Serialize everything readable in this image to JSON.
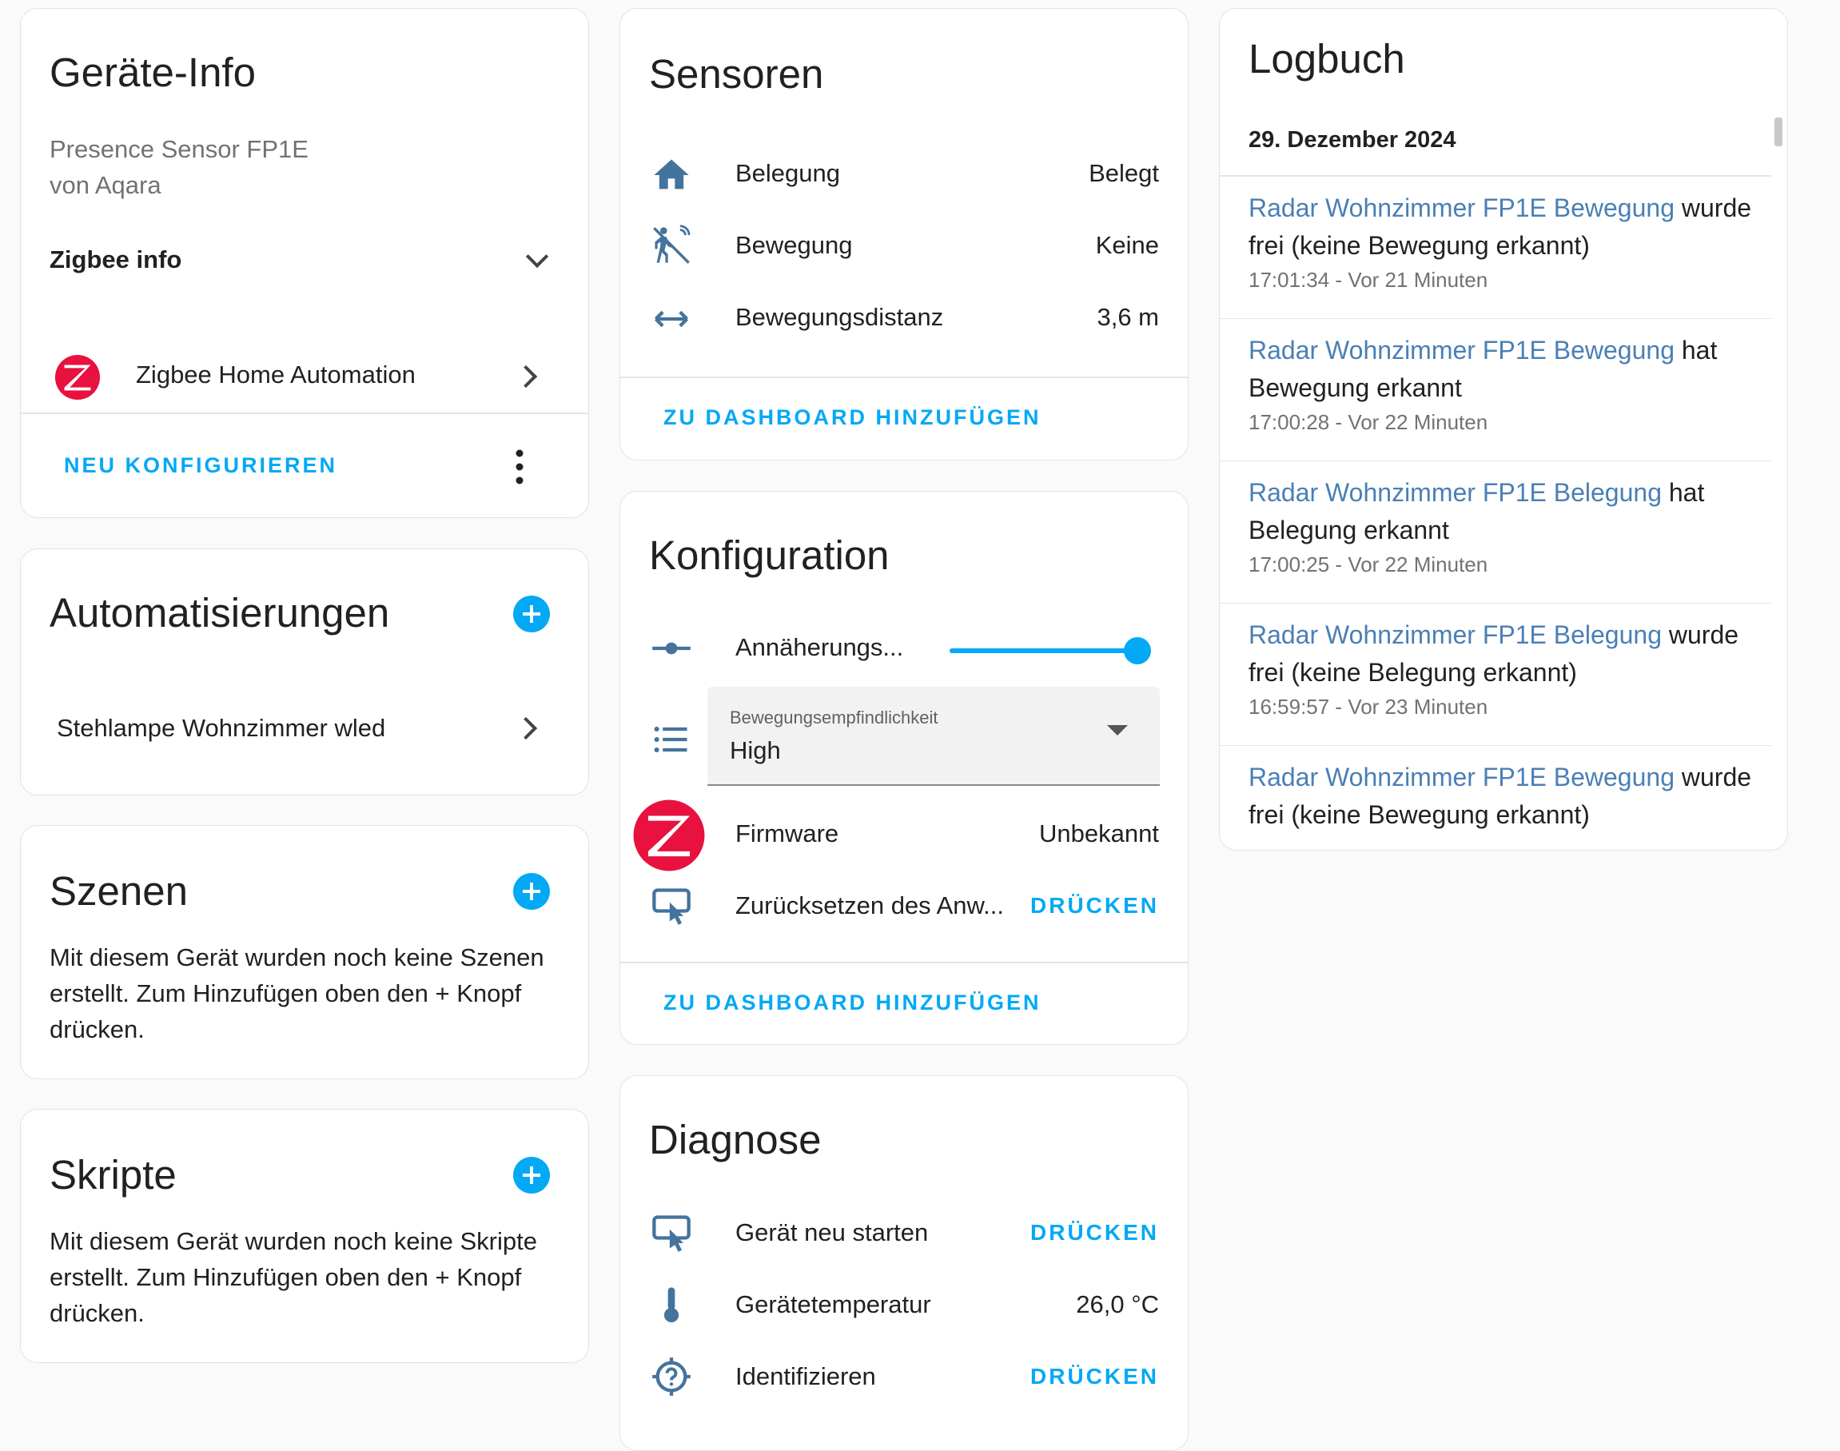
{
  "device_info": {
    "title": "Geräte-Info",
    "model": "Presence Sensor FP1E",
    "manufacturer": "von Aqara",
    "zigbee_info_label": "Zigbee info",
    "integration": "Zigbee Home Automation",
    "reconfigure_label": "NEU KONFIGURIEREN"
  },
  "automations": {
    "title": "Automatisierungen",
    "items": [
      "Stehlampe Wohnzimmer wled"
    ]
  },
  "scenes": {
    "title": "Szenen",
    "empty_text": "Mit diesem Gerät wurden noch keine Szenen erstellt. Zum Hinzufügen oben den + Knopf drücken."
  },
  "scripts": {
    "title": "Skripte",
    "empty_text": "Mit diesem Gerät wurden noch keine Skripte erstellt. Zum Hinzufügen oben den + Knopf drücken."
  },
  "sensors": {
    "title": "Sensoren",
    "rows": [
      {
        "icon": "home-icon",
        "label": "Belegung",
        "value": "Belegt"
      },
      {
        "icon": "motion-sensor-icon",
        "label": "Bewegung",
        "value": "Keine"
      },
      {
        "icon": "arrow-left-right-icon",
        "label": "Bewegungsdistanz",
        "value": "3,6 m"
      }
    ],
    "add_label": "ZU DASHBOARD HINZUFÜGEN"
  },
  "configuration": {
    "title": "Konfiguration",
    "slider_label": "Annäherungs...",
    "slider_value_fraction": 1.0,
    "select_label": "Bewegungsempfindlichkeit",
    "select_value": "High",
    "firmware_label": "Firmware",
    "firmware_value": "Unbekannt",
    "reset_label": "Zurücksetzen des Anw...",
    "press_label": "DRÜCKEN",
    "add_label": "ZU DASHBOARD HINZUFÜGEN"
  },
  "diagnostics": {
    "title": "Diagnose",
    "restart_label": "Gerät neu starten",
    "restart_action": "DRÜCKEN",
    "temp_label": "Gerätetemperatur",
    "temp_value": "26,0 °C",
    "identify_label": "Identifizieren",
    "identify_action": "DRÜCKEN"
  },
  "logbook": {
    "title": "Logbuch",
    "date": "29. Dezember 2024",
    "entries": [
      {
        "entity": "Radar Wohnzimmer FP1E Bewegung",
        "text": " wurde frei (keine Bewegung erkannt)",
        "time": "17:01:34 - Vor 21 Minuten"
      },
      {
        "entity": "Radar Wohnzimmer FP1E Bewegung",
        "text": " hat Bewegung erkannt",
        "time": "17:00:28 - Vor 22 Minuten"
      },
      {
        "entity": "Radar Wohnzimmer FP1E Belegung",
        "text": " hat Belegung erkannt",
        "time": "17:00:25 - Vor 22 Minuten"
      },
      {
        "entity": "Radar Wohnzimmer FP1E Belegung",
        "text": " wurde frei (keine Belegung erkannt)",
        "time": "16:59:57 - Vor 23 Minuten"
      },
      {
        "entity": "Radar Wohnzimmer FP1E Bewegung",
        "text": " wurde frei (keine Bewegung erkannt)",
        "time": ""
      }
    ]
  },
  "colors": {
    "accent": "#03a9f4",
    "icon": "#44739e",
    "zigbee_red": "#e8113f",
    "entity_link": "#4a7fb5"
  }
}
